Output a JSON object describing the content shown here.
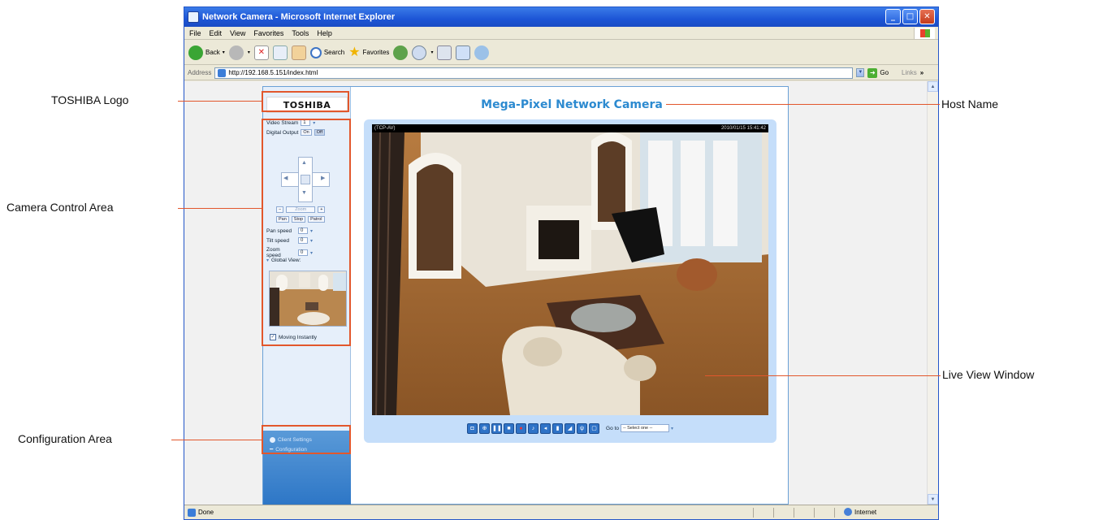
{
  "window": {
    "title": "Network Camera - Microsoft Internet Explorer",
    "minimize": "_",
    "maximize": "□",
    "close": "✕"
  },
  "menu": [
    "File",
    "Edit",
    "View",
    "Favorites",
    "Tools",
    "Help"
  ],
  "toolbar": {
    "back": "Back",
    "search": "Search",
    "favorites": "Favorites"
  },
  "address": {
    "label": "Address",
    "url": "http://192.168.5.151/index.html",
    "go": "Go",
    "links": "Links"
  },
  "page": {
    "logo": "TOSHIBA",
    "host_name": "Mega-Pixel Network Camera",
    "controls": {
      "video_stream_label": "Video Stream",
      "video_stream_value": "1",
      "digital_output_label": "Digital Output",
      "digital_output_on": "On",
      "digital_output_off": "Off",
      "zoom_label": "Zoom",
      "zoom_minus": "−",
      "zoom_plus": "+",
      "pan_btn": "Pan",
      "stop_btn": "Stop",
      "patrol_btn": "Patrol",
      "pan_speed_label": "Pan speed",
      "pan_speed_value": "0",
      "tilt_speed_label": "Tilt speed",
      "tilt_speed_value": "0",
      "zoom_speed_label": "Zoom speed",
      "zoom_speed_value": "0",
      "global_view_label": "Global View:",
      "moving_instantly_label": "Moving Instantly",
      "moving_instantly_checked": true
    },
    "config": {
      "client_settings": "Client Settings",
      "configuration": "Configuration"
    },
    "live_view": {
      "protocol": "(TCP-AV)",
      "timestamp": "2010/01/15 15:41:42",
      "goto_label": "Go to",
      "goto_value": "-- Select one --"
    }
  },
  "status": {
    "text": "Done",
    "zone": "Internet"
  },
  "callouts": {
    "logo": "TOSHIBA Logo",
    "camera_control": "Camera Control Area",
    "configuration": "Configuration Area",
    "host_name": "Host Name",
    "live_view": "Live View Window"
  },
  "colors": {
    "callout_accent": "#e2572c",
    "host_name": "#2c8ad0",
    "xp_title": "#1d55d6"
  }
}
